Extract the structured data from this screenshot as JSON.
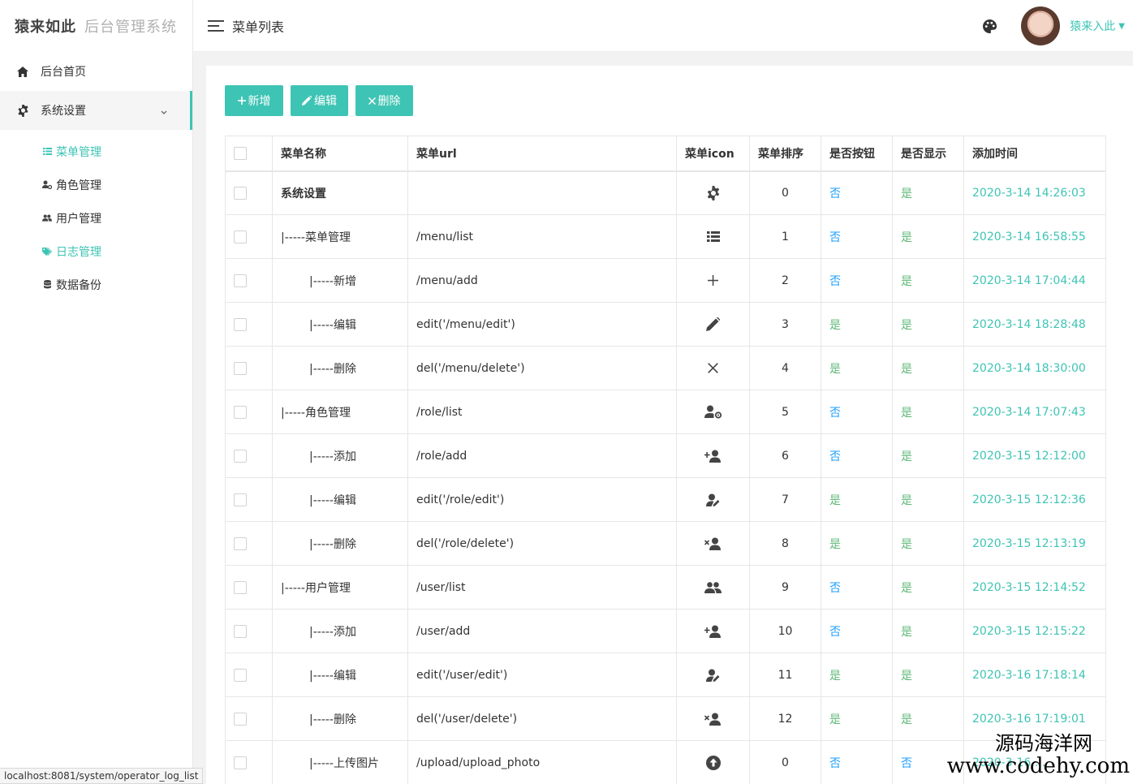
{
  "brand": {
    "name": "猿来如此",
    "subtitle": "后台管理系统"
  },
  "header": {
    "title": "菜单列表",
    "user_name": "猿来入此"
  },
  "sidebar": {
    "items": [
      {
        "label": "后台首页",
        "icon": "home-icon"
      },
      {
        "label": "系统设置",
        "icon": "gear-icon"
      }
    ],
    "sub_items": [
      {
        "label": "菜单管理",
        "icon": "list-icon",
        "active": true
      },
      {
        "label": "角色管理",
        "icon": "user-cog-icon",
        "active": false
      },
      {
        "label": "用户管理",
        "icon": "users-icon",
        "active": false
      },
      {
        "label": "日志管理",
        "icon": "tags-icon",
        "active": true
      },
      {
        "label": "数据备份",
        "icon": "database-icon",
        "active": false
      }
    ]
  },
  "status_bar": {
    "url": "localhost:8081/system/operator_log_list"
  },
  "toolbar": {
    "add_label": "新增",
    "edit_label": "编辑",
    "delete_label": "删除"
  },
  "table": {
    "headers": [
      "菜单名称",
      "菜单url",
      "菜单icon",
      "菜单排序",
      "是否按钮",
      "是否显示",
      "添加时间"
    ],
    "rows": [
      {
        "name": "系统设置",
        "url": "",
        "icon": "gear-icon",
        "sort": "0",
        "is_button": "否",
        "is_show": "是",
        "time": "2020-3-14 14:26:03"
      },
      {
        "name": "|-----菜单管理",
        "url": "/menu/list",
        "icon": "list-icon",
        "sort": "1",
        "is_button": "否",
        "is_show": "是",
        "time": "2020-3-14 16:58:55"
      },
      {
        "name": "|-----新增",
        "url": "/menu/add",
        "icon": "plus-icon",
        "sort": "2",
        "is_button": "否",
        "is_show": "是",
        "time": "2020-3-14 17:04:44"
      },
      {
        "name": "|-----编辑",
        "url": "edit('/menu/edit')",
        "icon": "pencil-icon",
        "sort": "3",
        "is_button": "是",
        "is_show": "是",
        "time": "2020-3-14 18:28:48"
      },
      {
        "name": "|-----删除",
        "url": "del('/menu/delete')",
        "icon": "close-icon",
        "sort": "4",
        "is_button": "是",
        "is_show": "是",
        "time": "2020-3-14 18:30:00"
      },
      {
        "name": "|-----角色管理",
        "url": "/role/list",
        "icon": "user-cog-icon",
        "sort": "5",
        "is_button": "否",
        "is_show": "是",
        "time": "2020-3-14 17:07:43"
      },
      {
        "name": "|-----添加",
        "url": "/role/add",
        "icon": "user-plus-icon",
        "sort": "6",
        "is_button": "否",
        "is_show": "是",
        "time": "2020-3-15 12:12:00"
      },
      {
        "name": "|-----编辑",
        "url": "edit('/role/edit')",
        "icon": "user-edit-icon",
        "sort": "7",
        "is_button": "是",
        "is_show": "是",
        "time": "2020-3-15 12:12:36"
      },
      {
        "name": "|-----删除",
        "url": "del('/role/delete')",
        "icon": "user-times-icon",
        "sort": "8",
        "is_button": "是",
        "is_show": "是",
        "time": "2020-3-15 12:13:19"
      },
      {
        "name": "|-----用户管理",
        "url": "/user/list",
        "icon": "users-icon",
        "sort": "9",
        "is_button": "否",
        "is_show": "是",
        "time": "2020-3-15 12:14:52"
      },
      {
        "name": "|-----添加",
        "url": "/user/add",
        "icon": "user-plus-icon",
        "sort": "10",
        "is_button": "否",
        "is_show": "是",
        "time": "2020-3-15 12:15:22"
      },
      {
        "name": "|-----编辑",
        "url": "edit('/user/edit')",
        "icon": "user-edit-icon",
        "sort": "11",
        "is_button": "是",
        "is_show": "是",
        "time": "2020-3-16 17:18:14"
      },
      {
        "name": "|-----删除",
        "url": "del('/user/delete')",
        "icon": "user-times-icon",
        "sort": "12",
        "is_button": "是",
        "is_show": "是",
        "time": "2020-3-16 17:19:01"
      },
      {
        "name": "|-----上传图片",
        "url": "/upload/upload_photo",
        "icon": "upload-circle-icon",
        "sort": "0",
        "is_button": "否",
        "is_show": "否",
        "time": "2020-3-16 ..."
      }
    ]
  },
  "watermark": {
    "line1": "源码海洋网",
    "line2": "www.codehy.com"
  },
  "colors": {
    "accent": "#3ec4b4",
    "no": "#1e9fff",
    "yes": "#5fb878"
  }
}
